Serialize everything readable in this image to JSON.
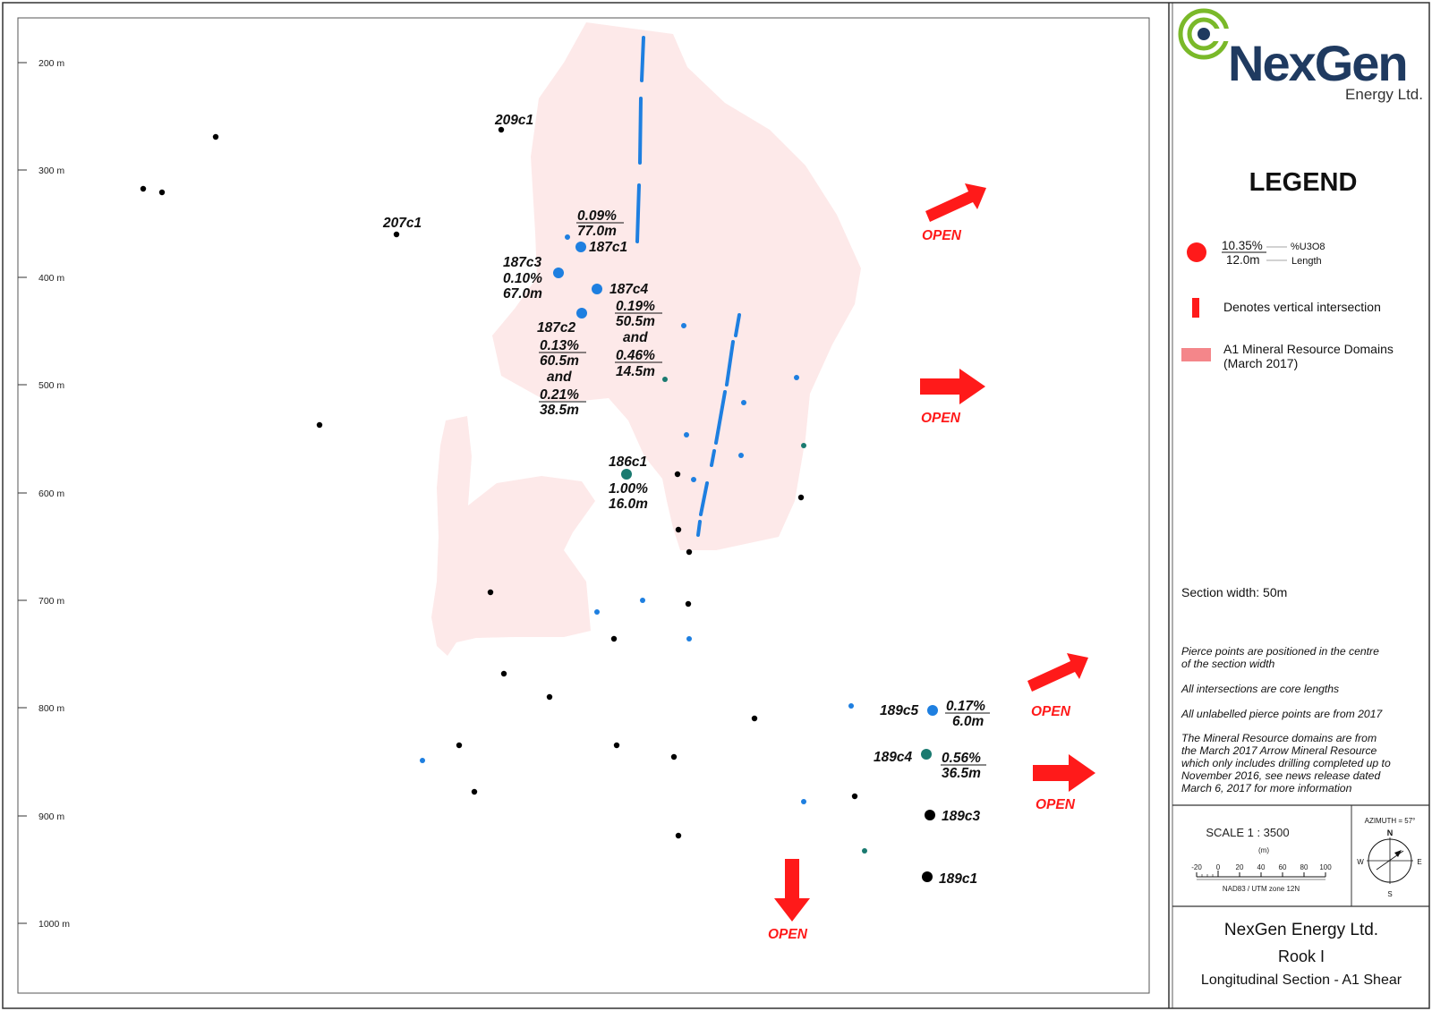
{
  "brand": {
    "name": "NexGen",
    "sub": "Energy Ltd."
  },
  "legend": {
    "title": "LEGEND",
    "sample_grade": "10.35%",
    "sample_length": "12.0m",
    "grade_label": "%U3O8",
    "length_label": "Length",
    "vertical_label": "Denotes vertical intersection",
    "domain_label_1": "A1 Mineral Resource Domains",
    "domain_label_2": "(March 2017)"
  },
  "section_width": "Section width: 50m",
  "notes": {
    "n1a": "Pierce points are positioned in the centre",
    "n1b": "of the section width",
    "n2": "All intersections are core lengths",
    "n3": "All unlabelled pierce points are from 2017",
    "n4a": "The Mineral Resource domains are from",
    "n4b": "the March 2017 Arrow Mineral Resource",
    "n4c": "which only includes drilling completed up to",
    "n4d": "November 2016, see news release dated",
    "n4e": "March 6, 2017 for more information"
  },
  "scale": {
    "label": "SCALE  1 : 3500",
    "unit": "(m)",
    "ticks": [
      "-20",
      "0",
      "20",
      "40",
      "60",
      "80",
      "100"
    ],
    "datum": "NAD83 / UTM zone 12N"
  },
  "compass": {
    "azimuth": "AZIMUTH = 57°",
    "n": "N",
    "s": "S",
    "e": "E",
    "w": "W"
  },
  "titleblock": {
    "company": "NexGen Energy Ltd.",
    "project": "Rook I",
    "section": "Longitudinal Section - A1 Shear"
  },
  "depth_axis": [
    "200 m",
    "300 m",
    "400 m",
    "500 m",
    "600 m",
    "700 m",
    "800 m",
    "900 m",
    "1000 m"
  ],
  "open_label": "OPEN",
  "holes": [
    {
      "name": "209c1"
    },
    {
      "name": "207c1"
    },
    {
      "name": "187c1",
      "grade": "0.09%",
      "length": "77.0m"
    },
    {
      "name": "187c3",
      "grade": "0.10%",
      "length": "67.0m"
    },
    {
      "name": "187c4",
      "grade": "0.19%",
      "length": "50.5m",
      "and": "and",
      "grade2": "0.46%",
      "length2": "14.5m"
    },
    {
      "name": "187c2",
      "grade": "0.13%",
      "length": "60.5m",
      "and": "and",
      "grade2": "0.21%",
      "length2": "38.5m"
    },
    {
      "name": "186c1",
      "grade": "1.00%",
      "length": "16.0m"
    },
    {
      "name": "189c5",
      "grade": "0.17%",
      "length": "6.0m"
    },
    {
      "name": "189c4",
      "grade": "0.56%",
      "length": "36.5m"
    },
    {
      "name": "189c3"
    },
    {
      "name": "189c1"
    }
  ],
  "colors": {
    "domain": "#fde9e9",
    "intersection": "#1e7fe0",
    "arrow": "#ff1a1a",
    "green": "#1a7a70",
    "brand_green": "#7ab929",
    "brand_navy": "#1f3a60"
  }
}
